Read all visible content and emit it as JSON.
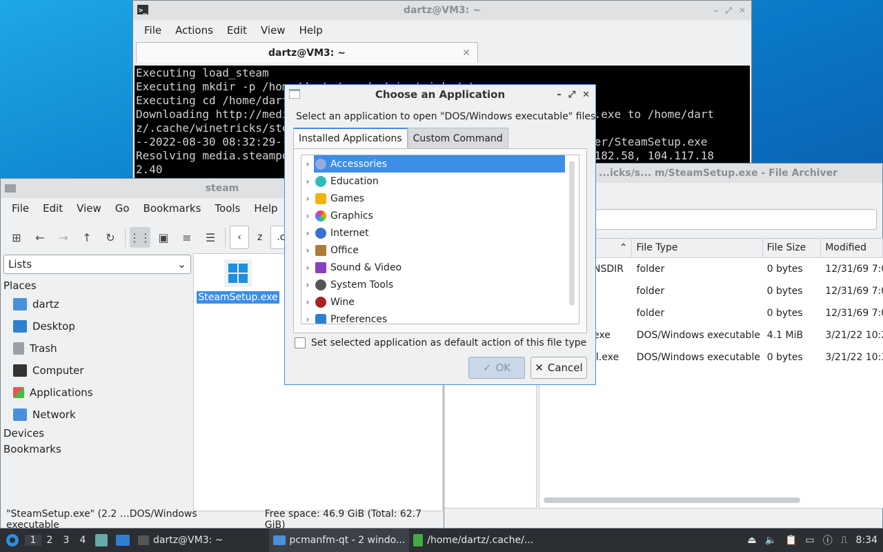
{
  "terminal": {
    "title": "dartz@VM3: ~",
    "menu": [
      "File",
      "Actions",
      "Edit",
      "View",
      "Help"
    ],
    "tab_title": "dartz@VM3: ~",
    "lines": [
      "Executing load_steam",
      "Executing mkdir -p /home/dartz/.cache/winetricks/steam",
      "Executing cd /home/dartz/.cache/winetricks/steam",
      "Downloading http://media.steampowered.com/client/installer/SteamSetup.exe to /home/dart",
      "z/.cache/winetricks/steam",
      "--2022-08-30 08:32:29--  http://media.steampowered.com/client/installer/SteamSetup.exe",
      "Resolving media.steampowered.com (media.steampowered.com)... 104.117.182.58, 104.117.18",
      "2.40"
    ]
  },
  "archiver": {
    "title": "...icks/s... m/SteamSetup.exe - File Archiver",
    "columns": [
      "",
      "File Type",
      "File Size",
      "Modified"
    ],
    "rows": [
      {
        "name": "NSDIR",
        "type": "folder",
        "size": "0 bytes",
        "modified": "12/31/69 7:0"
      },
      {
        "name": "",
        "type": "folder",
        "size": "0 bytes",
        "modified": "12/31/69 7:0"
      },
      {
        "name": "",
        "type": "folder",
        "size": "0 bytes",
        "modified": "12/31/69 7:0"
      },
      {
        "name": "exe",
        "type": "DOS/Windows executable",
        "size": "4.1 MiB",
        "modified": "3/21/22 10:2"
      },
      {
        "name": "ll.exe",
        "type": "DOS/Windows executable",
        "size": "0 bytes",
        "modified": "3/21/22 10:3"
      }
    ]
  },
  "filemgr": {
    "title": "steam",
    "menu": [
      "File",
      "Edit",
      "View",
      "Go",
      "Bookmarks",
      "Tools",
      "Help"
    ],
    "crumbs": [
      "z",
      ".ca"
    ],
    "side_mode": "Lists",
    "places_header": "Places",
    "places": [
      "dartz",
      "Desktop",
      "Trash",
      "Computer",
      "Applications",
      "Network"
    ],
    "devices_header": "Devices",
    "bookmarks_header": "Bookmarks",
    "file": "SteamSetup.exe",
    "status_selected": "\"SteamSetup.exe\" (2.2 …DOS/Windows executable",
    "status_free": "Free space: 46.9 GiB (Total: 62.7 GiB)"
  },
  "dialog": {
    "title": "Choose an Application",
    "prompt": "Select an application to open \"DOS/Windows executable\" files",
    "tabs": [
      "Installed Applications",
      "Custom Command"
    ],
    "categories": [
      "Accessories",
      "Education",
      "Games",
      "Graphics",
      "Internet",
      "Office",
      "Sound & Video",
      "System Tools",
      "Wine",
      "Preferences"
    ],
    "default_label": "Set selected application as default action of this file type",
    "ok_label": "OK",
    "cancel_label": "Cancel"
  },
  "taskbar": {
    "workspaces": [
      "1",
      "2",
      "3",
      "4"
    ],
    "tasks": [
      "dartz@VM3: ~",
      "pcmanfm-qt - 2 windo...",
      "/home/dartz/.cache/..."
    ],
    "clock": "8:34"
  }
}
